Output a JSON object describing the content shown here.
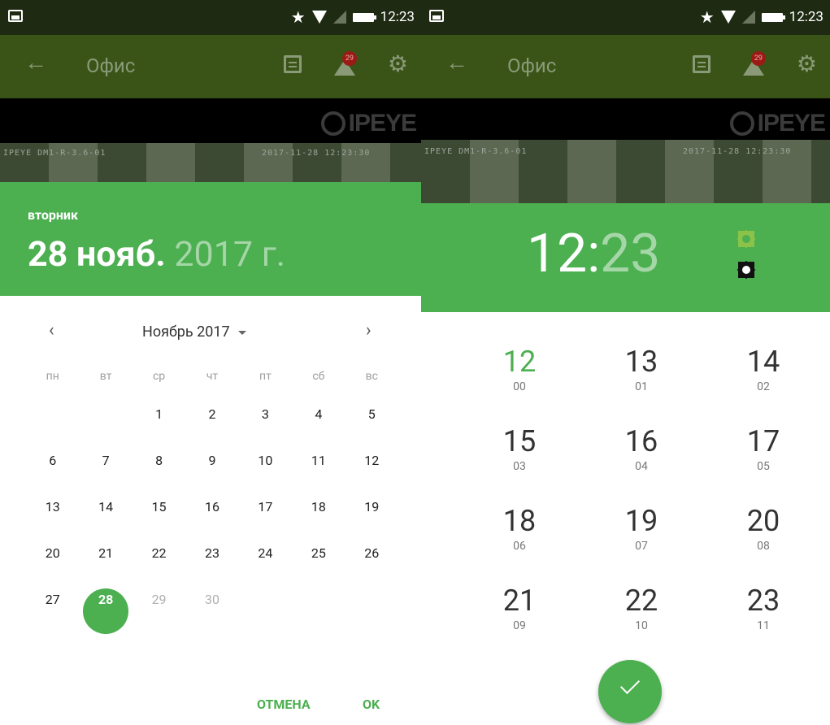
{
  "left": {
    "status": {
      "time": "12:23"
    },
    "appbar": {
      "title": "Офис",
      "notif_count": "29"
    },
    "camera": {
      "osd_left": "IPEYE DM1-R-3.6-01",
      "osd_ts": "2017-11-28 12:23:30",
      "logo": "IPEYE"
    },
    "date_header": {
      "weekday": "вторник",
      "day_month": "28 нояб.",
      "year": "2017 г."
    },
    "calendar": {
      "month_label": "Ноябрь 2017",
      "prev": "‹",
      "next": "›",
      "weekdays": [
        "пн",
        "вт",
        "ср",
        "чт",
        "пт",
        "сб",
        "вс"
      ],
      "days": [
        "",
        "",
        "1",
        "2",
        "3",
        "4",
        "5",
        "6",
        "7",
        "8",
        "9",
        "10",
        "11",
        "12",
        "13",
        "14",
        "15",
        "16",
        "17",
        "18",
        "19",
        "20",
        "21",
        "22",
        "23",
        "24",
        "25",
        "26",
        "27",
        "28",
        "29",
        "30",
        "",
        "",
        ""
      ],
      "selected_day": "28"
    },
    "actions": {
      "cancel": "ОТМЕНА",
      "ok": "OK"
    }
  },
  "right": {
    "status": {
      "time": "12:23"
    },
    "appbar": {
      "title": "Офис",
      "notif_count": "29"
    },
    "camera": {
      "osd_left": "IPEYE DM1-R-3.6-01",
      "osd_ts": "2017-11-28 12:23:30",
      "logo": "IPEYE"
    },
    "time_header": {
      "hours": "12",
      "colon": ":",
      "minutes": "23"
    },
    "hours": [
      {
        "h": "12",
        "sub": "00"
      },
      {
        "h": "13",
        "sub": "01"
      },
      {
        "h": "14",
        "sub": "02"
      },
      {
        "h": "15",
        "sub": "03"
      },
      {
        "h": "16",
        "sub": "04"
      },
      {
        "h": "17",
        "sub": "05"
      },
      {
        "h": "18",
        "sub": "06"
      },
      {
        "h": "19",
        "sub": "07"
      },
      {
        "h": "20",
        "sub": "08"
      },
      {
        "h": "21",
        "sub": "09"
      },
      {
        "h": "22",
        "sub": "10"
      },
      {
        "h": "23",
        "sub": "11"
      }
    ]
  },
  "colors": {
    "accent": "#4caf50",
    "appbar_dimmed": "#3a5417",
    "statusbar": "#1f2a13"
  },
  "icons": {
    "back": "back-arrow-icon",
    "calendar": "calendar-icon",
    "notifications": "notification-icon",
    "settings": "gear-icon",
    "star": "star-icon",
    "wifi": "wifi-icon",
    "battery": "battery-icon",
    "confirm": "check-icon",
    "theme_light": "brightness-light-icon",
    "theme_dark": "brightness-dark-icon"
  }
}
